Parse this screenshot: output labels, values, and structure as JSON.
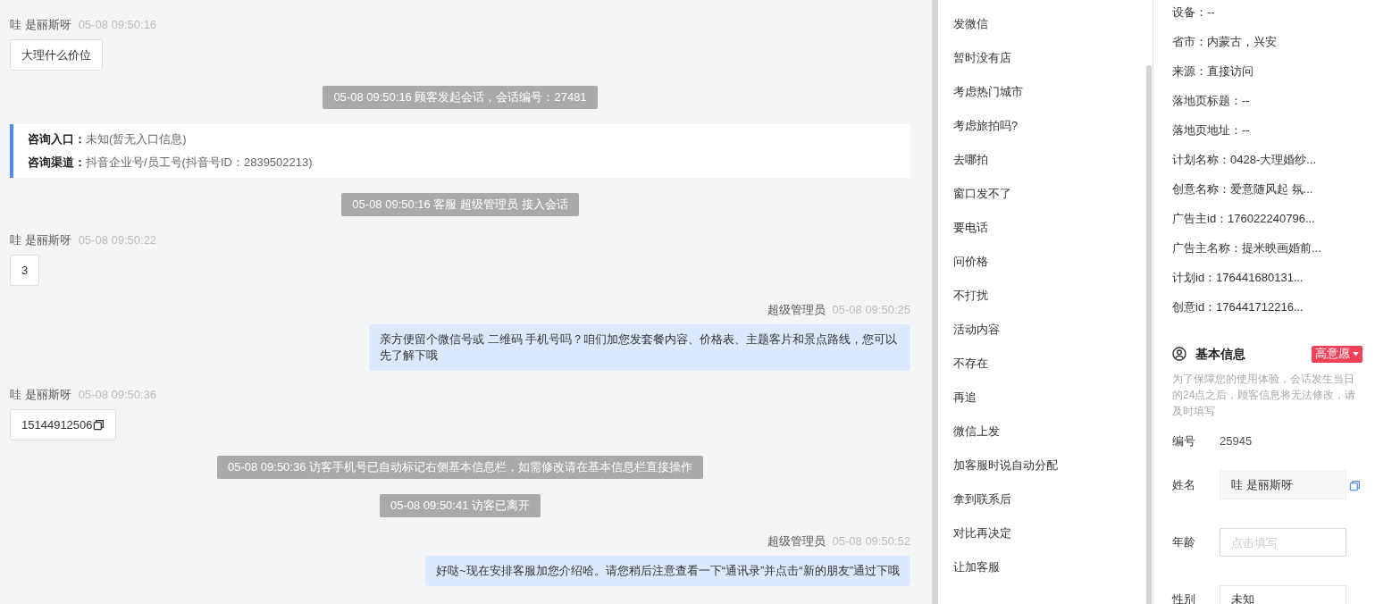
{
  "chat": {
    "messages": [
      {
        "kind": "visitor",
        "sender": "哇 是丽斯呀",
        "time": "05-08 09:50:16",
        "text": "大理什么价位",
        "copy_icon": false
      },
      {
        "kind": "system",
        "text": "05-08 09:50:16 顾客发起会话，会话编号：27481"
      },
      {
        "kind": "entry_info",
        "lines": [
          {
            "label": "咨询入口：",
            "value": "未知(暂无入口信息)"
          },
          {
            "label": "咨询渠道：",
            "value": "抖音企业号/员工号(抖音号ID：2839502213)"
          }
        ]
      },
      {
        "kind": "system",
        "text": "05-08 09:50:16 客服 超级管理员 接入会话"
      },
      {
        "kind": "visitor",
        "sender": "哇 是丽斯呀",
        "time": "05-08 09:50:22",
        "text": "3",
        "copy_icon": false
      },
      {
        "kind": "agent",
        "sender": "超级管理员",
        "time": "05-08 09:50:25",
        "text": "亲方便留个微信号或 二维码 手机号吗？咱们加您发套餐内容、价格表、主题客片和景点路线，您可以先了解下哦"
      },
      {
        "kind": "visitor",
        "sender": "哇 是丽斯呀",
        "time": "05-08 09:50:36",
        "text": "15144912506",
        "copy_icon": true
      },
      {
        "kind": "system",
        "text": "05-08 09:50:36 访客手机号已自动标记右侧基本信息栏，如需修改请在基本信息栏直接操作"
      },
      {
        "kind": "system",
        "text": "05-08 09:50:41 访客已离开"
      },
      {
        "kind": "agent",
        "sender": "超级管理员",
        "time": "05-08 09:50:52",
        "text": "好哒~现在安排客服加您介绍哈。请您稍后注意查看一下“通讯录”并点击“新的朋友”通过下哦"
      }
    ]
  },
  "quick_replies": [
    "发微信",
    "暂时没有店",
    "考虑热门城市",
    "考虑旅拍吗?",
    "去哪拍",
    "窗口发不了",
    "要电话",
    "问价格",
    "不打扰",
    "活动内容",
    "不存在",
    "再追",
    "微信上发",
    "加客服时说自动分配",
    "拿到联系后",
    "对比再决定",
    "让加客服"
  ],
  "visitor_details": [
    "设备：--",
    "省市：内蒙古，兴安",
    "来源：直接访问",
    "落地页标题：--",
    "落地页地址：--",
    "计划名称：0428-大理婚纱...",
    "创意名称：爱意随风起 氛...",
    "广告主id：176022240796...",
    "广告主名称：提米映画婚前...",
    "计划id：176441680131...",
    "创意id：176441712216..."
  ],
  "basic_info": {
    "title": "基本信息",
    "intent_tag": "高意愿",
    "notice": "为了保障您的使用体验，会话发生当日的24点之后，顾客信息将无法修改，请及时填写",
    "fields": [
      {
        "label": "编号",
        "kind": "text",
        "value": "25945"
      },
      {
        "label": "姓名",
        "kind": "copyable",
        "value": "哇 是丽斯呀"
      },
      {
        "label": "年龄",
        "kind": "input",
        "placeholder": "点击填写"
      },
      {
        "label": "性别",
        "kind": "select",
        "value": "未知"
      }
    ]
  }
}
